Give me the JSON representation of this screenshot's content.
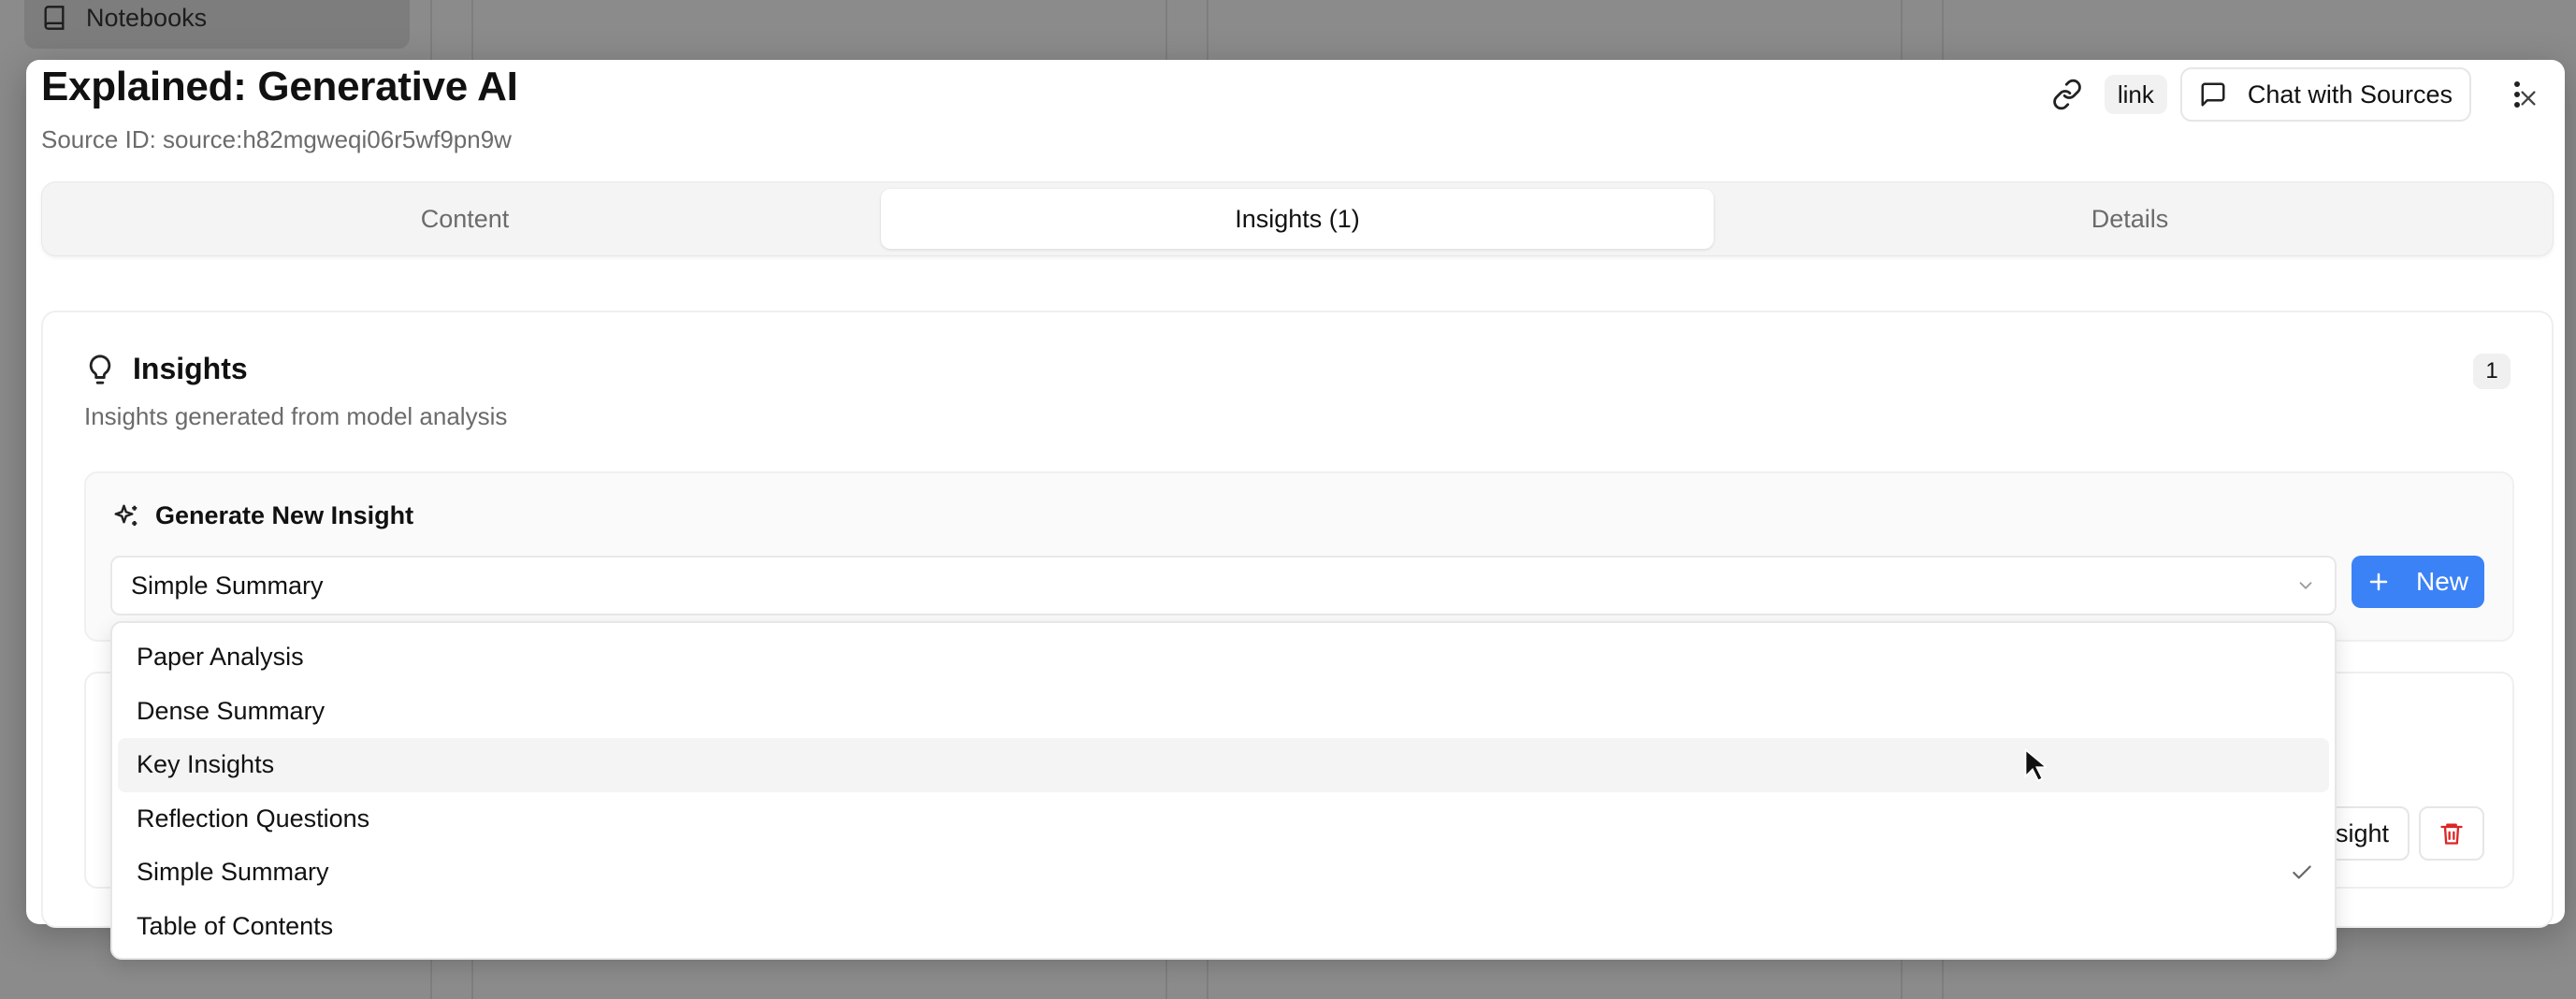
{
  "background": {
    "nav_item_label": "Notebooks"
  },
  "modal": {
    "title": "Explained: Generative AI",
    "source_id": "Source ID: source:h82mgweqi06r5wf9pn9w",
    "link_label": "link",
    "chat_label": "Chat with Sources"
  },
  "tabs": [
    {
      "label": "Content",
      "active": false
    },
    {
      "label": "Insights (1)",
      "active": true
    },
    {
      "label": "Details",
      "active": false
    }
  ],
  "insights": {
    "title": "Insights",
    "description": "Insights generated from model analysis",
    "count": "1",
    "generate_title": "Generate New Insight",
    "selected_value": "Simple Summary",
    "new_button_label": "New",
    "view_button_label": "sight"
  },
  "dropdown": {
    "options": [
      {
        "label": "Paper Analysis",
        "highlighted": false,
        "selected": false
      },
      {
        "label": "Dense Summary",
        "highlighted": false,
        "selected": false
      },
      {
        "label": "Key Insights",
        "highlighted": true,
        "selected": false
      },
      {
        "label": "Reflection Questions",
        "highlighted": false,
        "selected": false
      },
      {
        "label": "Simple Summary",
        "highlighted": false,
        "selected": true
      },
      {
        "label": "Table of Contents",
        "highlighted": false,
        "selected": false
      }
    ]
  },
  "colors": {
    "accent": "#3b82f6",
    "danger": "#dc2626",
    "overlay": "#8b8b8b"
  }
}
